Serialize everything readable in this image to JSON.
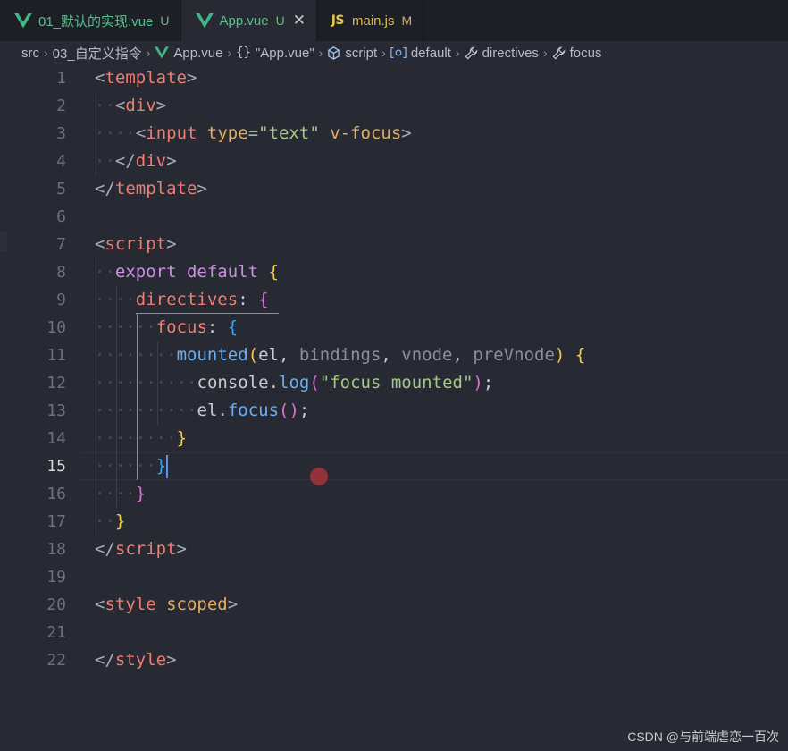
{
  "tabs": [
    {
      "name": "01_默认的实现.vue",
      "badge": "U",
      "kind": "vue",
      "active": false,
      "closable": false
    },
    {
      "name": "App.vue",
      "badge": "U",
      "kind": "vue",
      "active": true,
      "closable": true
    },
    {
      "name": "main.js",
      "badge": "M",
      "kind": "js",
      "active": false,
      "closable": false
    }
  ],
  "breadcrumb": {
    "items": [
      "src",
      "03_自定义指令",
      "App.vue",
      "\"App.vue\"",
      "script",
      "default",
      "directives",
      "focus"
    ],
    "icons": [
      "",
      "",
      "vue-icon",
      "braces-icon",
      "cube-icon",
      "variable-icon",
      "wrench-icon",
      "wrench-icon"
    ]
  },
  "editor": {
    "line_numbers": [
      "1",
      "2",
      "3",
      "4",
      "5",
      "6",
      "7",
      "8",
      "9",
      "10",
      "11",
      "12",
      "13",
      "14",
      "15",
      "16",
      "17",
      "18",
      "19",
      "20",
      "21",
      "22"
    ],
    "active_line": "15",
    "lines": [
      [
        [
          "t-punc",
          "<"
        ],
        [
          "t-tag",
          "template"
        ],
        [
          "t-punc",
          ">"
        ]
      ],
      [
        [
          "t-punc",
          "<"
        ],
        [
          "t-tag",
          "div"
        ],
        [
          "t-punc",
          ">"
        ]
      ],
      [
        [
          "t-punc",
          "<"
        ],
        [
          "t-tag",
          "input"
        ],
        [
          "t-plain",
          " "
        ],
        [
          "t-attr",
          "type"
        ],
        [
          "t-punc",
          "="
        ],
        [
          "t-str",
          "\"text\""
        ],
        [
          "t-plain",
          " "
        ],
        [
          "t-attr",
          "v-focus"
        ],
        [
          "t-punc",
          ">"
        ]
      ],
      [
        [
          "t-punc",
          "</"
        ],
        [
          "t-tag",
          "div"
        ],
        [
          "t-punc",
          ">"
        ]
      ],
      [
        [
          "t-punc",
          "</"
        ],
        [
          "t-tag",
          "template"
        ],
        [
          "t-punc",
          ">"
        ]
      ],
      [],
      [
        [
          "t-punc",
          "<"
        ],
        [
          "t-tag",
          "script"
        ],
        [
          "t-punc",
          ">"
        ]
      ],
      [
        [
          "t-kw",
          "export"
        ],
        [
          "t-plain",
          " "
        ],
        [
          "t-kw",
          "default"
        ],
        [
          "t-plain",
          " "
        ],
        [
          "t-b1",
          "{"
        ]
      ],
      [
        [
          "t-prop",
          "directives"
        ],
        [
          "t-plain",
          ": "
        ],
        [
          "t-b2",
          "{"
        ]
      ],
      [
        [
          "t-prop",
          "focus"
        ],
        [
          "t-plain",
          ": "
        ],
        [
          "t-b3",
          "{"
        ]
      ],
      [
        [
          "t-fn",
          "mounted"
        ],
        [
          "t-b1",
          "("
        ],
        [
          "t-plain",
          "el, "
        ],
        [
          "t-param",
          "bindings"
        ],
        [
          "t-plain",
          ", "
        ],
        [
          "t-param",
          "vnode"
        ],
        [
          "t-plain",
          ", "
        ],
        [
          "t-param",
          "preVnode"
        ],
        [
          "t-b1",
          ")"
        ],
        [
          "t-plain",
          " "
        ],
        [
          "t-b1",
          "{"
        ]
      ],
      [
        [
          "t-plain",
          "console."
        ],
        [
          "t-fn",
          "log"
        ],
        [
          "t-b2",
          "("
        ],
        [
          "t-str",
          "\"focus mounted\""
        ],
        [
          "t-b2",
          ")"
        ],
        [
          "t-plain",
          ";"
        ]
      ],
      [
        [
          "t-plain",
          "el."
        ],
        [
          "t-fn",
          "focus"
        ],
        [
          "t-b2",
          "()"
        ],
        [
          "t-plain",
          ";"
        ]
      ],
      [
        [
          "t-b1",
          "}"
        ]
      ],
      [
        [
          "t-b3",
          "}"
        ]
      ],
      [
        [
          "t-b2",
          "}"
        ]
      ],
      [
        [
          "t-b1",
          "}"
        ]
      ],
      [
        [
          "t-punc",
          "</"
        ],
        [
          "t-tag",
          "script"
        ],
        [
          "t-punc",
          ">"
        ]
      ],
      [],
      [
        [
          "t-punc",
          "<"
        ],
        [
          "t-tag",
          "style"
        ],
        [
          "t-plain",
          " "
        ],
        [
          "t-attr",
          "scoped"
        ],
        [
          "t-punc",
          ">"
        ]
      ],
      [],
      [
        [
          "t-punc",
          "</"
        ],
        [
          "t-tag",
          "style"
        ],
        [
          "t-punc",
          ">"
        ]
      ]
    ],
    "indents": [
      0,
      1,
      2,
      1,
      0,
      0,
      0,
      1,
      2,
      3,
      4,
      5,
      5,
      4,
      3,
      2,
      1,
      0,
      0,
      0,
      0,
      0
    ]
  },
  "watermark": "CSDN @与前端虐恋一百次",
  "colors": {
    "vue": "#41b883",
    "js_badge": "#e6c34c",
    "accent": "#5b95e8"
  }
}
